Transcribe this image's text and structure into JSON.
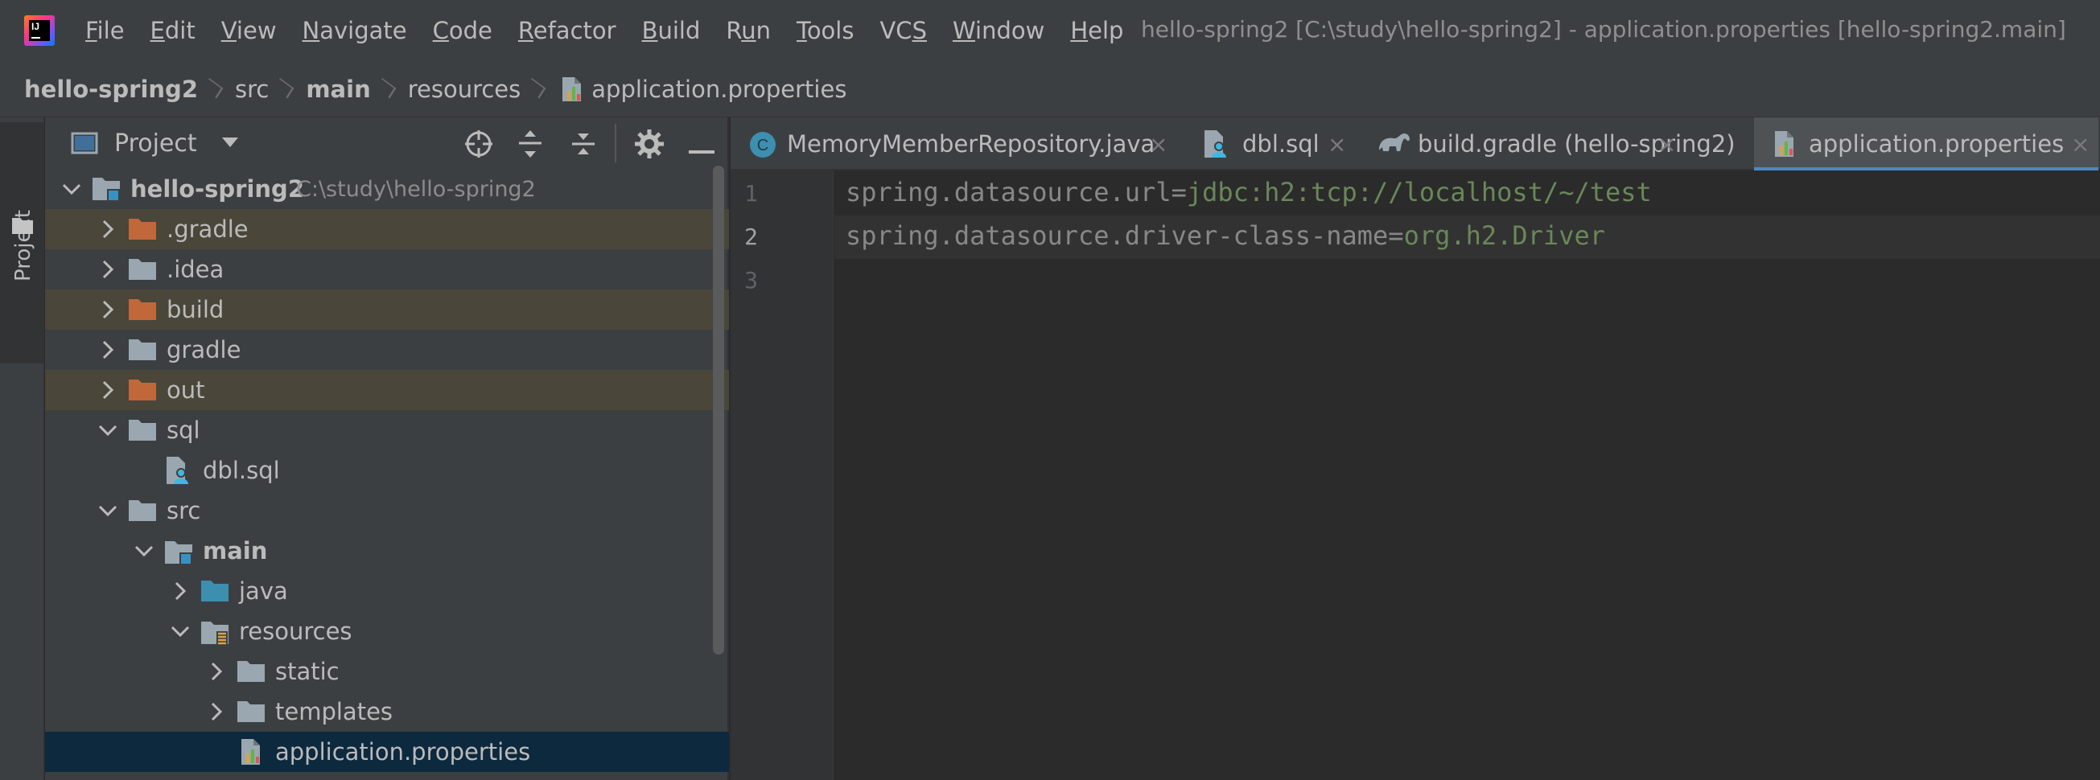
{
  "menubar": {
    "items": [
      {
        "pre": "",
        "u": "F",
        "post": "ile"
      },
      {
        "pre": "",
        "u": "E",
        "post": "dit"
      },
      {
        "pre": "",
        "u": "V",
        "post": "iew"
      },
      {
        "pre": "",
        "u": "N",
        "post": "avigate"
      },
      {
        "pre": "",
        "u": "C",
        "post": "ode"
      },
      {
        "pre": "",
        "u": "R",
        "post": "efactor"
      },
      {
        "pre": "",
        "u": "B",
        "post": "uild"
      },
      {
        "pre": "R",
        "u": "u",
        "post": "n"
      },
      {
        "pre": "",
        "u": "T",
        "post": "ools"
      },
      {
        "pre": "VC",
        "u": "S",
        "post": ""
      },
      {
        "pre": "",
        "u": "W",
        "post": "indow"
      },
      {
        "pre": "",
        "u": "H",
        "post": "elp"
      }
    ],
    "window_title": "hello-spring2 [C:\\study\\hello-spring2] - application.properties [hello-spring2.main]"
  },
  "breadcrumb": [
    "hello-spring2",
    "src",
    "main",
    "resources",
    "application.properties"
  ],
  "stripe": {
    "project_label": "Project"
  },
  "project_panel": {
    "title": "Project",
    "icons": [
      "locate-icon",
      "expand-all-icon",
      "collapse-all-icon",
      "settings-icon",
      "hide-icon"
    ],
    "root": {
      "name": "hello-spring2",
      "path": "C:\\study\\hello-spring2"
    },
    "items": [
      {
        "name": ".gradle",
        "kind": "folder-excluded",
        "expanded": false
      },
      {
        "name": ".idea",
        "kind": "folder",
        "expanded": false
      },
      {
        "name": "build",
        "kind": "folder-excluded",
        "expanded": false
      },
      {
        "name": "gradle",
        "kind": "folder",
        "expanded": false
      },
      {
        "name": "out",
        "kind": "folder-excluded",
        "expanded": false
      },
      {
        "name": "sql",
        "kind": "folder",
        "expanded": true
      },
      {
        "name": "dbl.sql",
        "kind": "sql-file"
      },
      {
        "name": "src",
        "kind": "folder",
        "expanded": true
      },
      {
        "name": "main",
        "kind": "module-folder",
        "expanded": true
      },
      {
        "name": "java",
        "kind": "source-folder",
        "expanded": false
      },
      {
        "name": "resources",
        "kind": "resources-folder",
        "expanded": true
      },
      {
        "name": "static",
        "kind": "folder",
        "expanded": false
      },
      {
        "name": "templates",
        "kind": "folder",
        "expanded": false
      },
      {
        "name": "application.properties",
        "kind": "properties-file"
      }
    ]
  },
  "editor": {
    "tabs": [
      {
        "label": "MemoryMemberRepository.java",
        "icon": "java-class-icon",
        "active": false
      },
      {
        "label": "dbl.sql",
        "icon": "sql-file-icon",
        "active": false
      },
      {
        "label": "build.gradle (hello-spring2)",
        "icon": "gradle-icon",
        "active": false
      },
      {
        "label": "application.properties",
        "icon": "properties-file-icon",
        "active": true
      }
    ],
    "close_glyph": "×",
    "line_numbers": [
      "1",
      "2",
      "3"
    ],
    "current_line": 2,
    "lines": [
      {
        "key": "spring.datasource.url=",
        "value": "jdbc:h2:tcp://localhost/~/test"
      },
      {
        "key": "spring.datasource.driver-class-name=",
        "value": "org.h2.Driver"
      },
      {
        "key": "",
        "value": ""
      }
    ]
  },
  "colors": {
    "background": "#2b2b2b",
    "chrome": "#3c3f41",
    "excluded_folder": "#c0683a",
    "excluded_row": "#4a4639",
    "selection": "#0d293e",
    "property_key": "#888888",
    "property_value": "#6a8759",
    "accent": "#4a88c7"
  }
}
